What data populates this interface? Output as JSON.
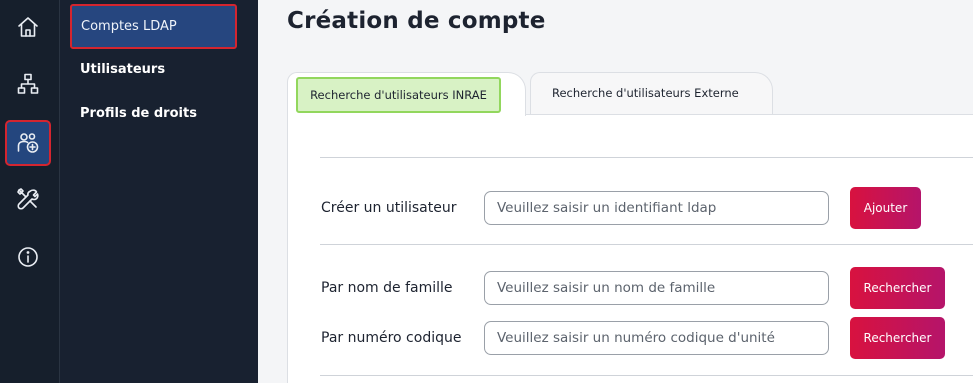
{
  "rail": {
    "items": [
      {
        "icon": "home-icon"
      },
      {
        "icon": "network-icon"
      },
      {
        "icon": "user-add-icon"
      },
      {
        "icon": "tools-icon"
      },
      {
        "icon": "info-icon"
      }
    ],
    "active_index": 2
  },
  "submenu": {
    "items": [
      {
        "label": "Comptes LDAP",
        "active": true
      },
      {
        "label": "Utilisateurs",
        "active": false
      },
      {
        "label": "Profils de droits",
        "active": false
      }
    ]
  },
  "main": {
    "title": "Création de compte",
    "tabs": [
      {
        "label": "Recherche d'utilisateurs INRAE",
        "active": true
      },
      {
        "label": "Recherche d'utilisateurs Externe",
        "active": false
      }
    ],
    "form": {
      "create": {
        "label": "Créer un utilisateur",
        "placeholder": "Veuillez saisir un identifiant ldap",
        "value": "",
        "button": "Ajouter"
      },
      "by_name": {
        "label": "Par nom de famille",
        "placeholder": "Veuillez saisir un nom de famille",
        "value": "",
        "button": "Rechercher"
      },
      "by_code": {
        "label": "Par numéro codique",
        "placeholder": "Veuillez saisir un numéro codique d'unité",
        "value": "",
        "button": "Rechercher"
      }
    }
  },
  "colors": {
    "rail_bg": "#161f2c",
    "submenu_bg": "#182130",
    "active_bg": "#26467f",
    "highlight_border": "#d4252f",
    "active_tab_bg": "#d8f2c5",
    "active_tab_border": "#92d75d",
    "button_start": "#d8123f",
    "button_end": "#b5146a"
  }
}
